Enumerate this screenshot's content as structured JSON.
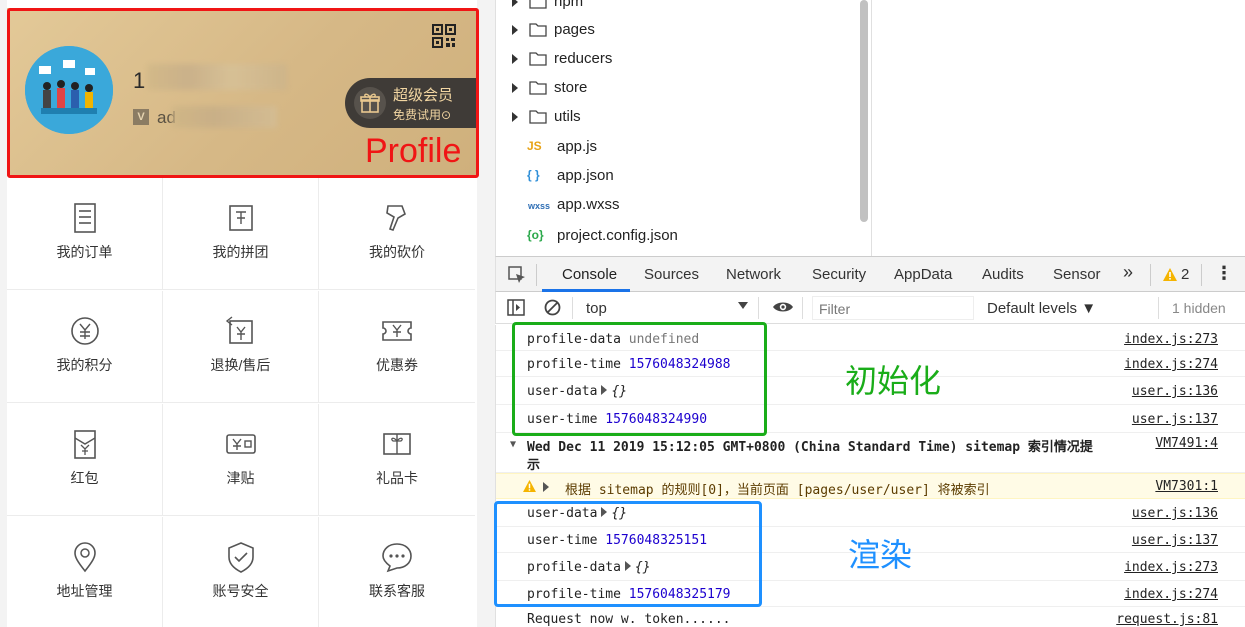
{
  "profile": {
    "name_visible": "1",
    "id_icon": "V",
    "id_prefix": "ad",
    "vip_title": "超级会员",
    "vip_sub": "免费试用⊙",
    "annotation": "Profile"
  },
  "grid": [
    {
      "label": "我的订单",
      "icon": "order-icon"
    },
    {
      "label": "我的拼团",
      "icon": "group-buy-icon"
    },
    {
      "label": "我的砍价",
      "icon": "bargain-icon"
    },
    {
      "label": "我的积分",
      "icon": "points-icon"
    },
    {
      "label": "退换/售后",
      "icon": "return-icon"
    },
    {
      "label": "优惠券",
      "icon": "coupon-icon"
    },
    {
      "label": "红包",
      "icon": "red-packet-icon"
    },
    {
      "label": "津贴",
      "icon": "allowance-icon"
    },
    {
      "label": "礼品卡",
      "icon": "gift-card-icon"
    },
    {
      "label": "地址管理",
      "icon": "location-icon"
    },
    {
      "label": "账号安全",
      "icon": "shield-icon"
    },
    {
      "label": "联系客服",
      "icon": "chat-icon"
    }
  ],
  "file_tree": {
    "folders": [
      "npm",
      "pages",
      "reducers",
      "store",
      "utils"
    ],
    "files": [
      {
        "icon": "JS",
        "name": "app.js",
        "color": "#e8a317"
      },
      {
        "icon": "{ }",
        "name": "app.json",
        "color": "#2f8fd8"
      },
      {
        "icon": "wxss",
        "name": "app.wxss",
        "color": "#2f6fb5"
      },
      {
        "icon": "{o}",
        "name": "project.config.json",
        "color": "#2aa84a"
      }
    ]
  },
  "tabs": {
    "items": [
      "Console",
      "Sources",
      "Network",
      "Security",
      "AppData",
      "Audits",
      "Sensor"
    ],
    "more": "»",
    "warnings": "2",
    "kebab": "⋮"
  },
  "toolbar": {
    "context": "top",
    "filter_placeholder": "Filter",
    "levels": "Default levels ▼",
    "hidden": "1 hidden"
  },
  "console": {
    "rows": [
      {
        "label": "profile-data",
        "value": "undefined",
        "kind": "undef",
        "src": "index.js:273"
      },
      {
        "label": "profile-time",
        "value": "1576048324988",
        "kind": "num",
        "src": "index.js:274"
      },
      {
        "label": "user-data",
        "value": "{}",
        "kind": "obj",
        "src": "user.js:136"
      },
      {
        "label": "user-time",
        "value": "1576048324990",
        "kind": "num",
        "src": "user.js:137"
      }
    ],
    "sitemap_line1": "Wed Dec 11 2019 15:12:05 GMT+0800 (China Standard Time) sitemap 索引情况提",
    "sitemap_line2": "示",
    "sitemap_src": "VM7491:4",
    "warn_text": "根据 sitemap 的规则[0]，当前页面 [pages/user/user] 将被索引",
    "warn_src": "VM7301:1",
    "rows2": [
      {
        "label": "user-data",
        "value": "{}",
        "kind": "obj",
        "src": "user.js:136"
      },
      {
        "label": "user-time",
        "value": "1576048325151",
        "kind": "num",
        "src": "user.js:137"
      },
      {
        "label": "profile-data",
        "value": "{}",
        "kind": "obj",
        "src": "index.js:273"
      },
      {
        "label": "profile-time",
        "value": "1576048325179",
        "kind": "num",
        "src": "index.js:274"
      }
    ],
    "last_line": "Request now w. token......",
    "last_src": "request.js:81"
  },
  "annotations": {
    "init": "初始化",
    "render": "渲染"
  },
  "colors": {
    "profile_outline": "#f01515",
    "init_box": "#1aad19",
    "render_box": "#1e90ff",
    "number": "#1c00cf"
  }
}
